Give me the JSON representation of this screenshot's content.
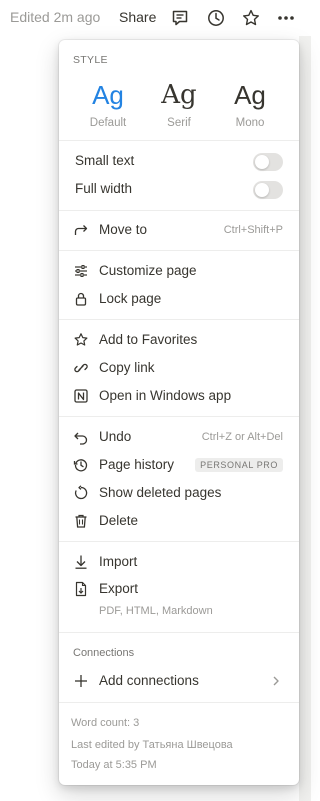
{
  "topbar": {
    "edited": "Edited 2m ago",
    "share": "Share",
    "icons": [
      "comment-icon",
      "clock-icon",
      "star-icon",
      "more-icon"
    ]
  },
  "style": {
    "section_label": "STYLE",
    "options": [
      {
        "glyph": "Ag",
        "name": "Default",
        "selected": true
      },
      {
        "glyph": "Ag",
        "name": "Serif",
        "selected": false
      },
      {
        "glyph": "Ag",
        "name": "Mono",
        "selected": false
      }
    ],
    "accent_color": "#2383e2"
  },
  "toggles": [
    {
      "label": "Small text",
      "on": false
    },
    {
      "label": "Full width",
      "on": false
    }
  ],
  "menu": {
    "move_to": {
      "label": "Move to",
      "shortcut": "Ctrl+Shift+P",
      "icon": "arrow-right-turn-icon"
    },
    "customize_page": {
      "label": "Customize page",
      "icon": "sliders-icon"
    },
    "lock_page": {
      "label": "Lock page",
      "icon": "lock-icon"
    },
    "add_favorites": {
      "label": "Add to Favorites",
      "icon": "star-icon"
    },
    "copy_link": {
      "label": "Copy link",
      "icon": "link-icon"
    },
    "open_windows": {
      "label": "Open in Windows app",
      "icon": "notion-logo-icon"
    },
    "undo": {
      "label": "Undo",
      "shortcut": "Ctrl+Z or Alt+Del",
      "icon": "undo-icon"
    },
    "page_history": {
      "label": "Page history",
      "badge": "PERSONAL PRO",
      "icon": "history-icon"
    },
    "show_deleted": {
      "label": "Show deleted pages",
      "icon": "restore-icon"
    },
    "delete": {
      "label": "Delete",
      "icon": "trash-icon"
    },
    "import": {
      "label": "Import",
      "icon": "import-icon"
    },
    "export": {
      "label": "Export",
      "sub": "PDF, HTML, Markdown",
      "icon": "export-file-icon"
    }
  },
  "connections": {
    "section_label": "Connections",
    "add_label": "Add connections"
  },
  "footer": {
    "word_count": "Word count: 3",
    "last_edited": "Last edited by Татьяна Швецова",
    "time": "Today at 5:35 PM"
  }
}
